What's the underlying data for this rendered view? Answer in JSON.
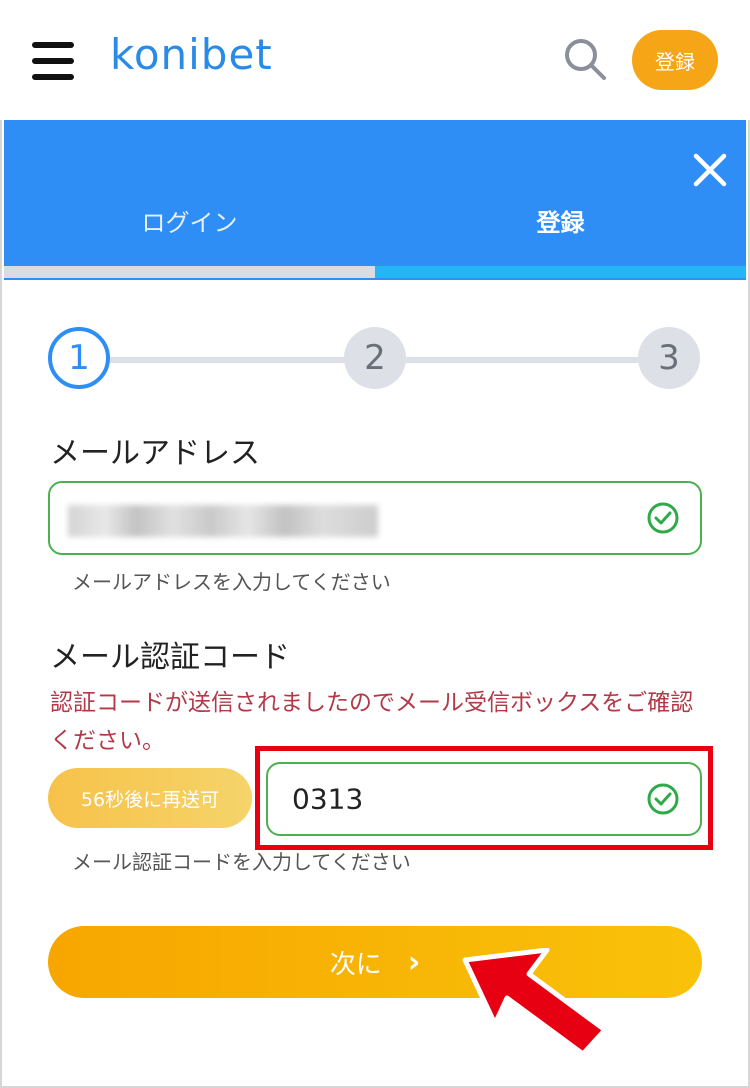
{
  "header": {
    "logo_text": "konibet",
    "register_label": "登録",
    "menu_icon": "hamburger-menu-icon",
    "search_icon": "search-icon"
  },
  "tabs": {
    "login_label": "ログイン",
    "register_label": "登録",
    "close_icon": "close-icon",
    "active": "register"
  },
  "stepper": {
    "steps": [
      "1",
      "2",
      "3"
    ],
    "current": 1
  },
  "form": {
    "email": {
      "label": "メールアドレス",
      "value": "",
      "hint": "メールアドレスを入力してください",
      "status": "valid"
    },
    "code": {
      "label": "メール認証コード",
      "notice": "認証コードが送信されましたのでメール受信ボックスをご確認ください。",
      "resend_label": "56秒後に再送可",
      "value": "0313",
      "hint": "メール認証コードを入力してください",
      "status": "valid"
    },
    "next_label": "次に",
    "next_icon": "chevron-right-icon"
  },
  "colors": {
    "brand_blue": "#2f8ef5",
    "accent_orange": "#f6a516",
    "valid_green": "#4caf50",
    "notice_red": "#b23a48",
    "highlight_red": "#e60012"
  }
}
